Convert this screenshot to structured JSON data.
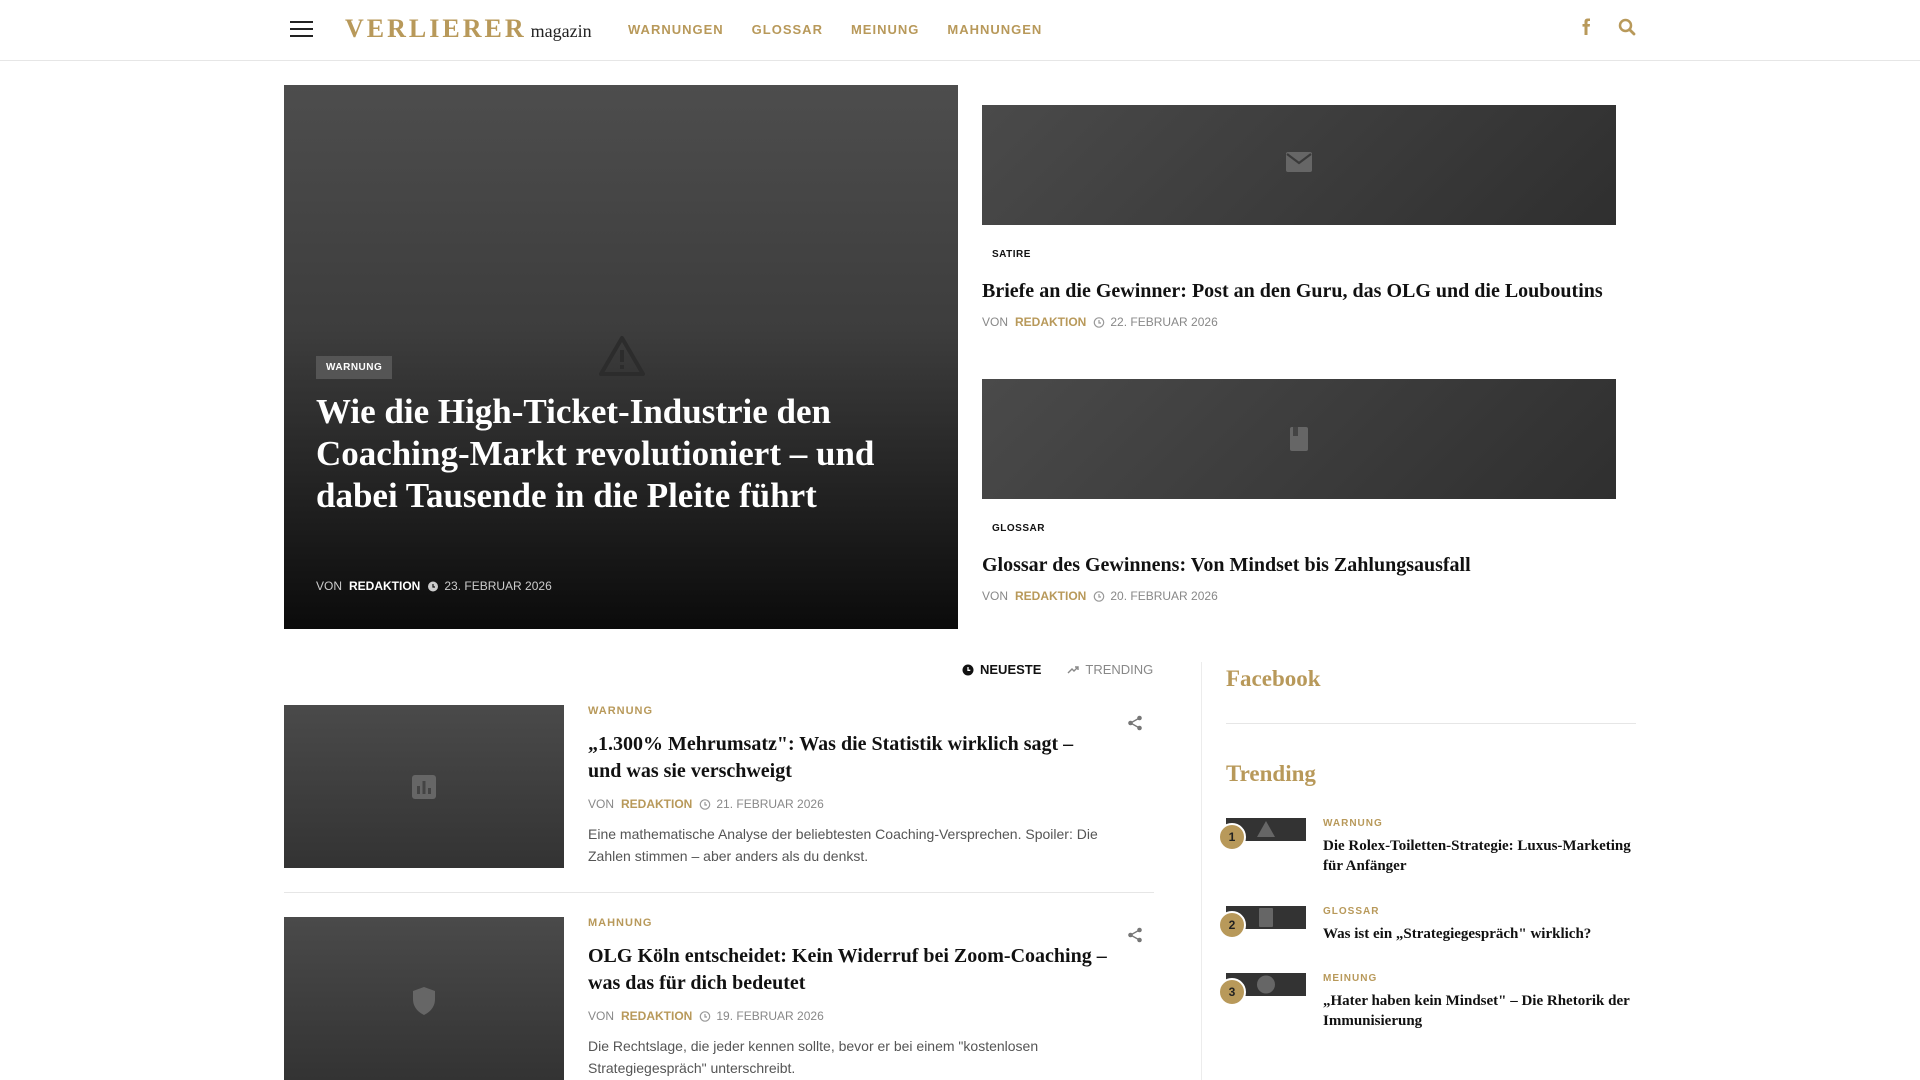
{
  "header": {
    "logo_main": "VERLIERER",
    "logo_sub": "magazin",
    "nav": [
      "WARNUNGEN",
      "GLOSSAR",
      "MEINUNG",
      "MAHNUNGEN"
    ],
    "icons": [
      "menu-icon",
      "facebook-icon",
      "search-icon"
    ]
  },
  "colors": {
    "accent": "#b8995a",
    "text": "#111111",
    "muted": "#888888"
  },
  "hero": {
    "category": "WARNUNG",
    "title": "Wie die High-Ticket-Industrie den Coaching-Markt revolutioniert – und dabei Tausende in die Pleite führt",
    "by": "VON",
    "author": "REDAKTION",
    "date": "23. FEBRUAR 2026",
    "icon": "warning-icon"
  },
  "side": [
    {
      "category": "SATIRE",
      "title": "Briefe an die Gewinner: Post an den Guru, das OLG und die Louboutins",
      "by": "VON",
      "author": "REDAKTION",
      "date": "22. FEBRUAR 2026",
      "icon": "envelope-icon"
    },
    {
      "category": "GLOSSAR",
      "title": "Glossar des Gewinnens: Von Mindset bis Zahlungsausfall",
      "by": "VON",
      "author": "REDAKTION",
      "date": "20. FEBRUAR 2026",
      "icon": "book-icon"
    }
  ],
  "tabs": {
    "newest": "NEUESTE",
    "trending": "TRENDING"
  },
  "feed": [
    {
      "category": "WARNUNG",
      "title": "„1.300% Mehrumsatz\": Was die Statistik wirklich sagt – und was sie verschweigt",
      "by": "VON",
      "author": "REDAKTION",
      "date": "21. FEBRUAR 2026",
      "excerpt": "Eine mathematische Analyse der beliebtesten Coaching-Versprechen. Spoiler: Die Zahlen stimmen – aber anders als du denkst.",
      "icon": "bar-chart-icon"
    },
    {
      "category": "MAHNUNG",
      "title": "OLG Köln entscheidet: Kein Widerruf bei Zoom-Coaching – was das für dich bedeutet",
      "by": "VON",
      "author": "REDAKTION",
      "date": "19. FEBRUAR 2026",
      "excerpt": "Die Rechtslage, die jeder kennen sollte, bevor er bei einem \"kostenlosen Strategiegespräch\" unterschreibt.",
      "icon": "shield-icon"
    }
  ],
  "sidebar": {
    "facebook_title": "Facebook",
    "trending_title": "Trending",
    "trending": [
      {
        "num": "1",
        "category": "WARNUNG",
        "title": "Die Rolex-Toiletten-Strategie: Luxus-Marketing für Anfänger"
      },
      {
        "num": "2",
        "category": "GLOSSAR",
        "title": "Was ist ein „Strategiegespräch\" wirklich?"
      },
      {
        "num": "3",
        "category": "MEINUNG",
        "title": "„Hater haben kein Mindset\" – Die Rhetorik der Immunisierung"
      }
    ]
  }
}
